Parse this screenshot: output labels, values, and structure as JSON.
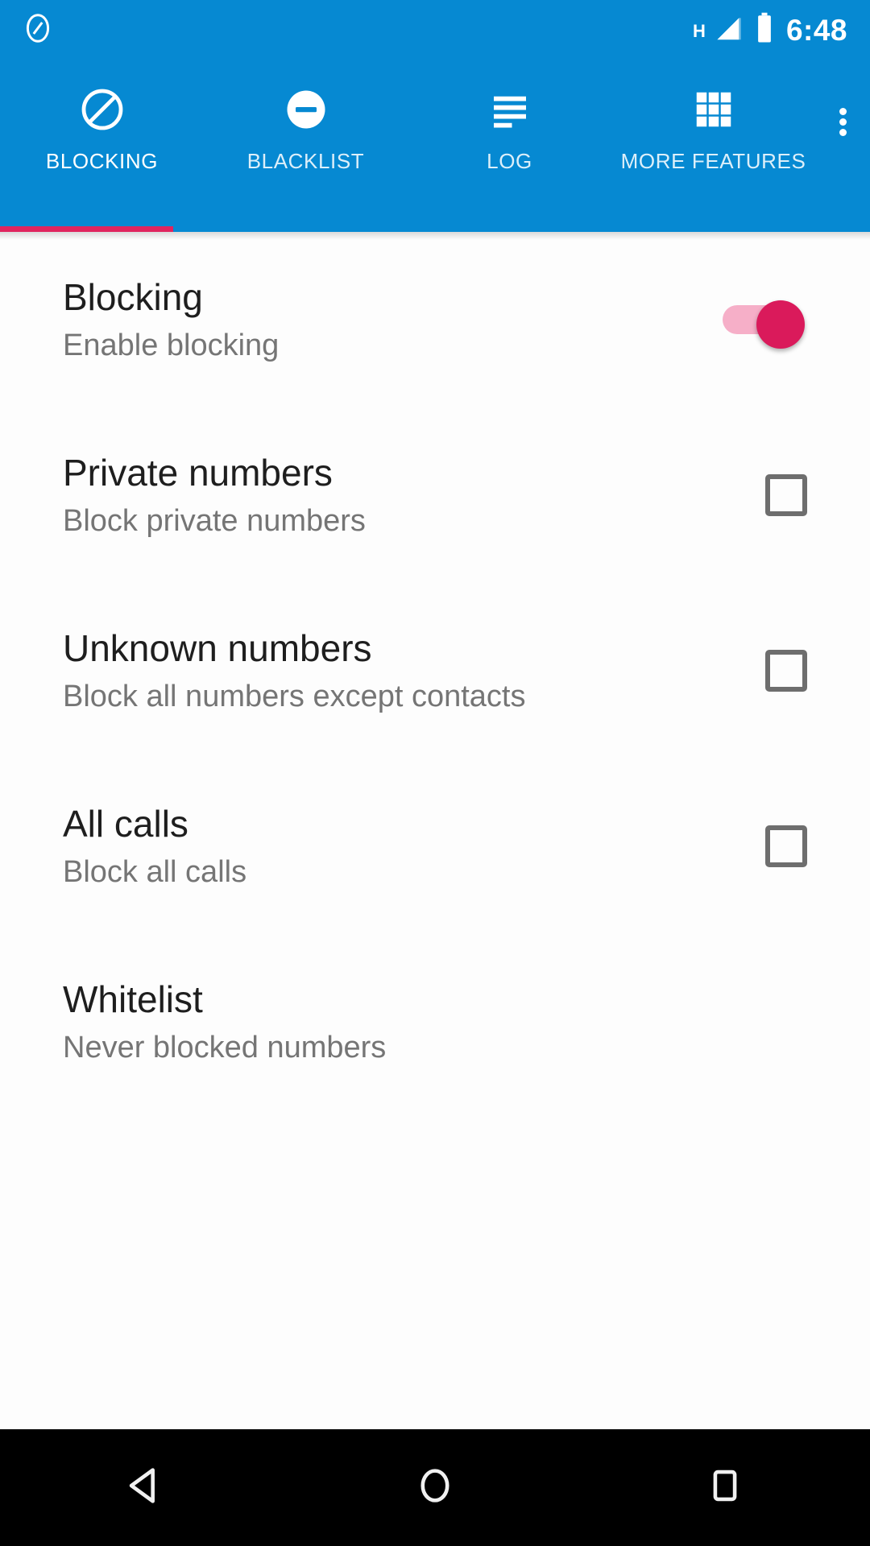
{
  "status_bar": {
    "notification_icon": "blocking-circle-slash-icon",
    "network_type": "H",
    "signal_icon": "signal-bars-icon",
    "battery_icon": "battery-full-icon",
    "time": "6:48"
  },
  "tabs": {
    "items": [
      {
        "label": "BLOCKING",
        "icon": "circle-slash-icon",
        "active": true
      },
      {
        "label": "BLACKLIST",
        "icon": "minus-circle-icon",
        "active": false
      },
      {
        "label": "LOG",
        "icon": "list-lines-icon",
        "active": false
      },
      {
        "label": "MORE FEATURES",
        "icon": "grid-apps-icon",
        "active": false
      }
    ],
    "overflow_menu": "overflow-menu-icon",
    "indicator_color": "#E0245E",
    "bar_color": "#0689D2"
  },
  "settings": {
    "rows": [
      {
        "title": "Blocking",
        "subtitle": "Enable blocking",
        "control": "switch",
        "checked": true
      },
      {
        "title": "Private numbers",
        "subtitle": "Block private numbers",
        "control": "checkbox",
        "checked": false
      },
      {
        "title": "Unknown numbers",
        "subtitle": "Block all numbers except contacts",
        "control": "checkbox",
        "checked": false
      },
      {
        "title": "All calls",
        "subtitle": "Block all calls",
        "control": "checkbox",
        "checked": false
      },
      {
        "title": "Whitelist",
        "subtitle": "Never blocked numbers",
        "control": "none",
        "checked": false
      }
    ],
    "switch_on_color": "#DA1A5B",
    "switch_track_color": "#F6AFC8",
    "checkbox_color": "#6E6E6E"
  },
  "navbar": {
    "back": "back-triangle-icon",
    "home": "home-circle-icon",
    "recents": "recents-square-icon"
  }
}
